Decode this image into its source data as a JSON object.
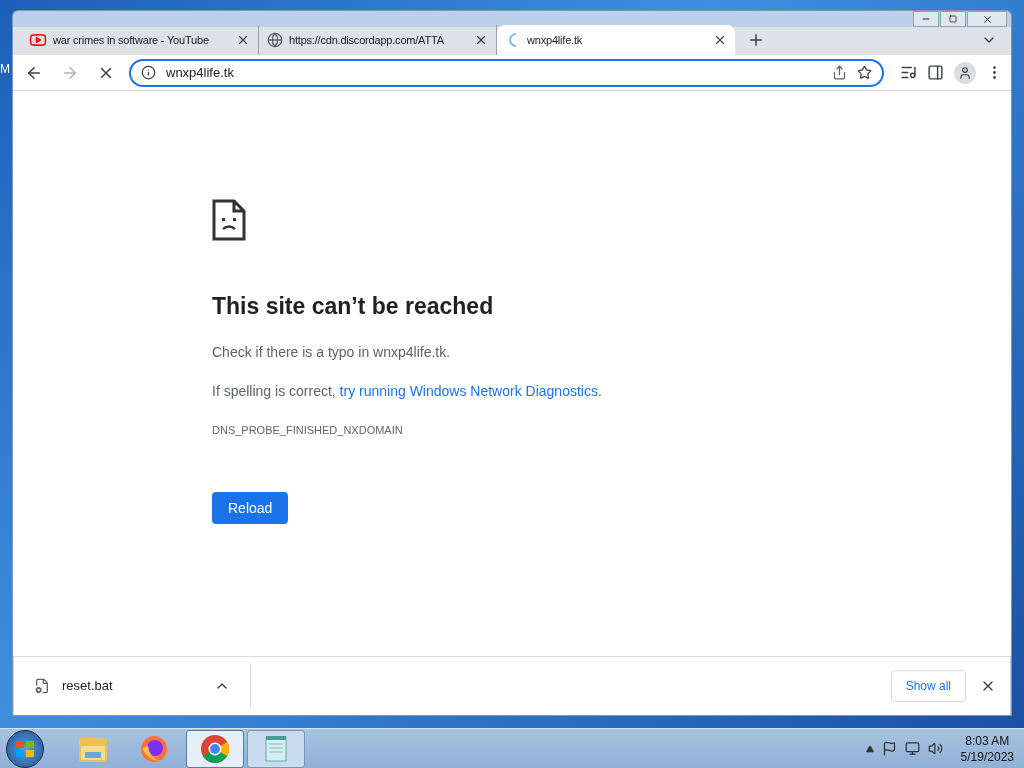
{
  "desktop": {
    "icon_label": "M"
  },
  "tabs": [
    {
      "title": "war crimes in software - YouTube",
      "kind": "youtube",
      "selected": false
    },
    {
      "title": "https://cdn.discordapp.com/ATTA",
      "kind": "globe",
      "selected": false
    },
    {
      "title": "wnxp4life.tk",
      "kind": "loading",
      "selected": true
    }
  ],
  "address_bar": {
    "value": "wnxp4life.tk"
  },
  "error": {
    "title": "This site can’t be reached",
    "line_1": "Check if there is a typo in wnxp4life.tk.",
    "line_2_prefix": "If spelling is correct, ",
    "line_2_link": "try running Windows Network Diagnostics",
    "line_2_suffix": ".",
    "code": "DNS_PROBE_FINISHED_NXDOMAIN",
    "button": "Reload"
  },
  "download_bar": {
    "file": "reset.bat",
    "button": "Show all"
  },
  "taskbar": {
    "apps": [
      {
        "kind": "explorer",
        "running": false,
        "selected": false
      },
      {
        "kind": "firefox",
        "running": false,
        "selected": false
      },
      {
        "kind": "chrome",
        "running": true,
        "selected": true
      },
      {
        "kind": "notepad",
        "running": true,
        "selected": false
      }
    ],
    "time": "8:03 AM",
    "date": "5/19/2023"
  }
}
